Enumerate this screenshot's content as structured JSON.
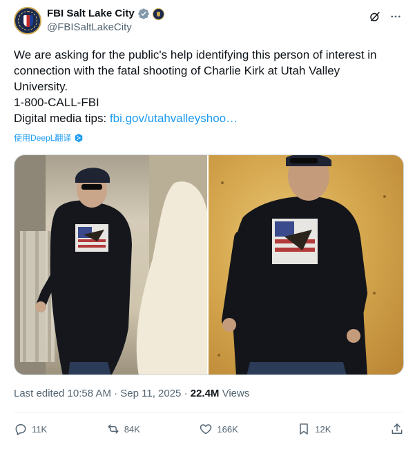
{
  "account": {
    "display_name": "FBI Salt Lake City",
    "handle": "@FBISaltLakeCity"
  },
  "tweet": {
    "lines": [
      "We are asking for the public's help identifying this person of interest in",
      "connection with the fatal shooting of Charlie Kirk at Utah Valley",
      "University.",
      "1-800-CALL-FBI"
    ],
    "tips_label": "Digital media tips:",
    "tips_link": "fbi.gov/utahvalleyshoo…",
    "translate_label": "使用DeepL翻译"
  },
  "meta": {
    "edited": "Last edited 10:58 AM · Sep 11, 2025 · ",
    "views_count": "22.4M",
    "views_label": " Views"
  },
  "actions": {
    "replies": "11K",
    "reposts": "84K",
    "likes": "166K",
    "bookmarks": "12K"
  },
  "icons": {
    "verified": "verified-badge-icon",
    "agency": "fbi-seal-icon",
    "grok": "grok-icon",
    "more": "more-icon",
    "reply": "reply-icon",
    "repost": "repost-icon",
    "like": "like-icon",
    "bookmark": "bookmark-icon",
    "share": "share-icon"
  },
  "colors": {
    "link": "#1d9bf0",
    "secondary_text": "#536471",
    "primary_text": "#0f1419"
  }
}
